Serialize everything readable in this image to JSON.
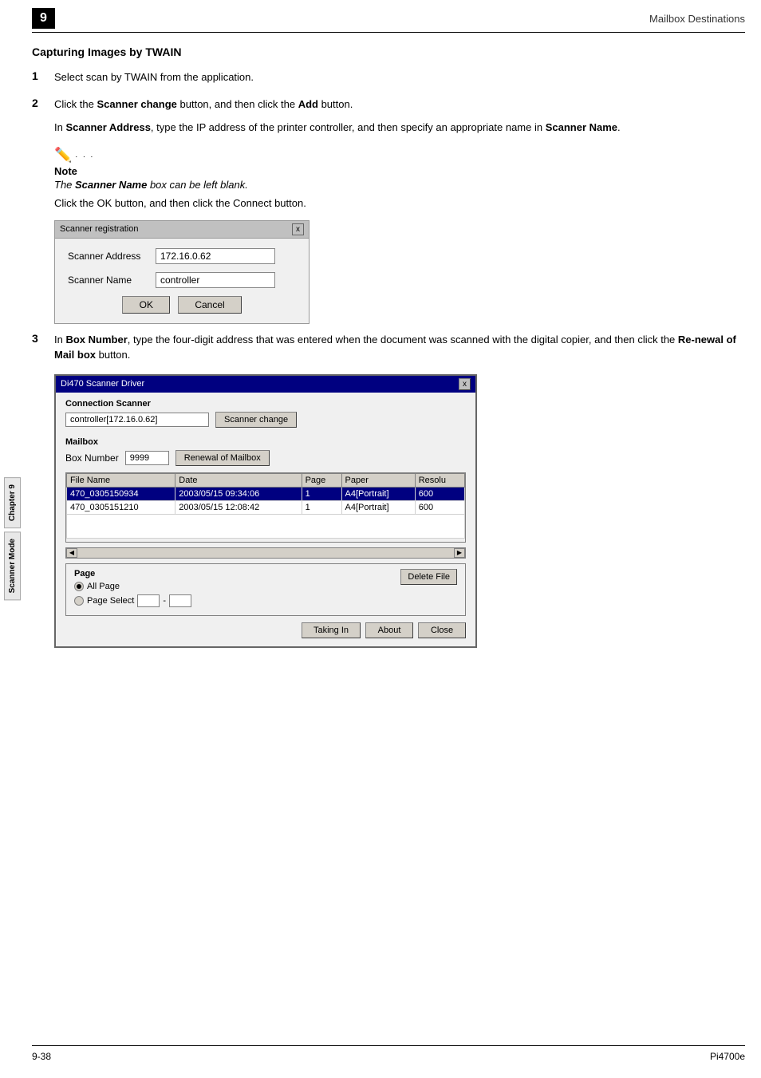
{
  "header": {
    "chapter_num": "9",
    "title": "Mailbox Destinations"
  },
  "sidebar": {
    "tab1": "Chapter 9",
    "tab2": "Scanner Mode"
  },
  "section": {
    "title": "Capturing Images by TWAIN"
  },
  "steps": {
    "step1": {
      "text": "Select scan by TWAIN from the application."
    },
    "step2": {
      "part1": "Click the ",
      "highlight1": "Scanner change",
      "part2": " button, and then click the ",
      "highlight2": "Add",
      "part3": " button.",
      "indent_text1": "In ",
      "indent_hl1": "Scanner Address",
      "indent_txt2": ", type the IP address of the printer controller, and then specify an appropriate name in ",
      "indent_hl2": "Scanner Name",
      "indent_txt3": "."
    },
    "step3": {
      "part1": "In ",
      "highlight1": "Box Number",
      "part2": ", type the four-digit address that was entered when the document was scanned with the digital copier, and then click the ",
      "highlight2": "Re-newal of Mail box",
      "part3": " button."
    }
  },
  "note": {
    "label": "Note",
    "text": "The ",
    "bold_text": "Scanner Name",
    "text2": " box can be left blank.",
    "click_text": "Click the ",
    "ok_bold": "OK",
    "button_text": " button, and then click the ",
    "connect_bold": "Connect",
    "button_text2": " button."
  },
  "scanner_registration_dialog": {
    "title": "Scanner registration",
    "close_btn": "x",
    "address_label": "Scanner Address",
    "address_value": "172.16.0.62",
    "name_label": "Scanner Name",
    "name_value": "controller",
    "ok_btn": "OK",
    "cancel_btn": "Cancel"
  },
  "driver_dialog": {
    "title": "Di470 Scanner Driver",
    "close_btn": "x",
    "connection_section": "Connection Scanner",
    "scanner_value": "controller[172.16.0.62]",
    "scanner_change_btn": "Scanner change",
    "mailbox_section": "Mailbox",
    "box_number_label": "Box Number",
    "box_number_value": "9999",
    "renewal_btn": "Renewal of Mailbox",
    "table_headers": [
      "File Name",
      "Date",
      "Page",
      "Paper",
      "Resolu"
    ],
    "table_rows": [
      {
        "filename": "470_0305150934",
        "date": "2003/05/15 09:34:06",
        "page": "1",
        "paper": "A4[Portrait]",
        "resolu": "600",
        "selected": true
      },
      {
        "filename": "470_0305151210",
        "date": "2003/05/15 12:08:42",
        "page": "1",
        "paper": "A4[Portrait]",
        "resolu": "600",
        "selected": false
      }
    ],
    "page_section_label": "Page",
    "all_page_label": "All Page",
    "page_select_label": "Page Select",
    "delete_file_btn": "Delete File",
    "taking_in_btn": "Taking In",
    "about_btn": "About",
    "close_btn2": "Close"
  },
  "footer": {
    "left": "9-38",
    "right": "Pi4700e"
  }
}
